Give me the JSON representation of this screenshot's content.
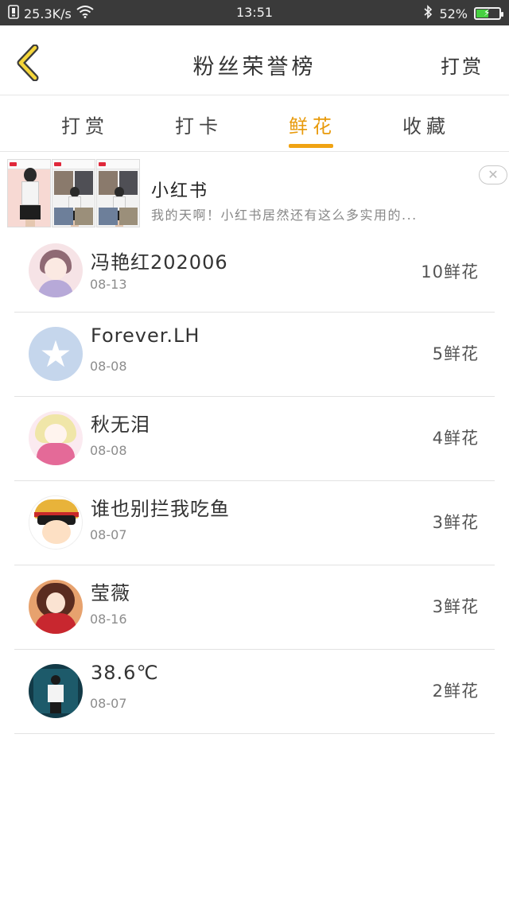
{
  "status_bar": {
    "speed": "25.3K/s",
    "time": "13:51",
    "battery_pct": "52%",
    "battery_level": 0.52
  },
  "header": {
    "title": "粉丝荣誉榜",
    "action": "打赏"
  },
  "tabs": [
    {
      "label": "打赏",
      "active": false
    },
    {
      "label": "打卡",
      "active": false
    },
    {
      "label": "鲜花",
      "active": true
    },
    {
      "label": "收藏",
      "active": false
    }
  ],
  "ad": {
    "title": "小红书",
    "desc": "我的天啊！小红书居然还有这么多实用的..."
  },
  "fans": [
    {
      "name": "冯艳红202006",
      "date": "08-13",
      "count": "10鲜花"
    },
    {
      "name": "Forever.LH",
      "date": "08-08",
      "count": "5鲜花"
    },
    {
      "name": "秋无泪",
      "date": "08-08",
      "count": "4鲜花"
    },
    {
      "name": "谁也别拦我吃鱼",
      "date": "08-07",
      "count": "3鲜花"
    },
    {
      "name": "莹薇",
      "date": "08-16",
      "count": "3鲜花"
    },
    {
      "name": "38.6℃",
      "date": "08-07",
      "count": "2鲜花"
    }
  ],
  "colors": {
    "accent": "#f0a313",
    "status_bar_bg": "#3a3a3a",
    "divider": "#e2e2e2"
  },
  "icons": {
    "back": "chevron-left-icon",
    "close": "close-icon",
    "wifi": "wifi-icon",
    "bluetooth": "bluetooth-icon",
    "battery": "battery-icon"
  }
}
